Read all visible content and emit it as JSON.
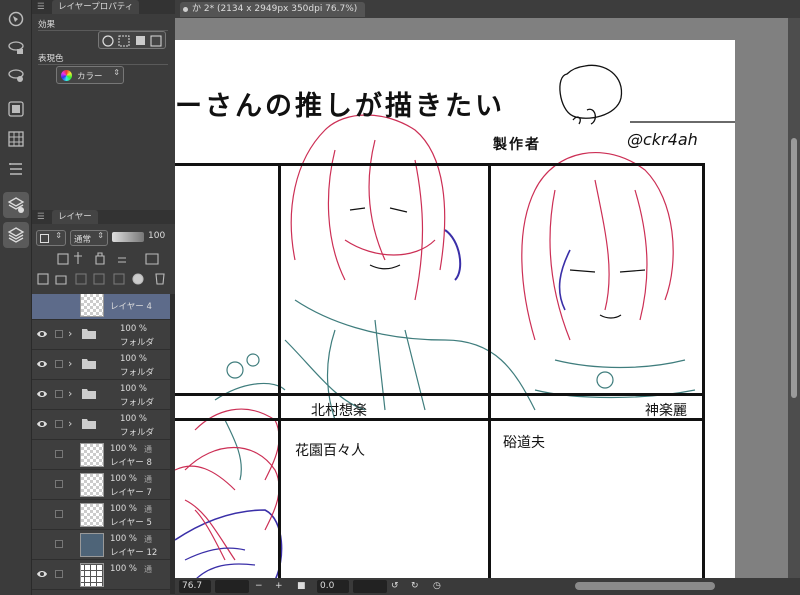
{
  "document_tab": {
    "title": "か 2* (2134 x 2949px 350dpi 76.7%)"
  },
  "left_strip": {
    "icons": [
      "navigator-icon",
      "sub-tool-detail-icon",
      "tool-property-icon",
      "material-icon",
      "color-set-icon",
      "layer-search-icon",
      "layer-property-icon",
      "layer-icon"
    ]
  },
  "property_panel": {
    "tab_label": "レイヤープロパティ",
    "effect_label": "効果",
    "expression_color_label": "表現色",
    "expression_color_value": "カラー"
  },
  "layer_panel": {
    "tab_label": "レイヤー",
    "blend_mode": "通常",
    "opacity": "100",
    "layers": [
      {
        "type": "layer",
        "name": "レイヤー 4",
        "opacity": "",
        "mode": "",
        "visible": false,
        "selected": true,
        "thumb": "transparent"
      },
      {
        "type": "folder",
        "name": "フォルダ",
        "opacity": "100 %",
        "mode": "",
        "visible": true,
        "selected": false
      },
      {
        "type": "folder",
        "name": "フォルダ",
        "opacity": "100 %",
        "mode": "",
        "visible": true,
        "selected": false
      },
      {
        "type": "folder",
        "name": "フォルダ",
        "opacity": "100 %",
        "mode": "",
        "visible": true,
        "selected": false
      },
      {
        "type": "folder",
        "name": "フォルダ",
        "opacity": "100 %",
        "mode": "",
        "visible": true,
        "selected": false
      },
      {
        "type": "layer",
        "name": "レイヤー 8",
        "opacity": "100 %",
        "mode": "通",
        "visible": false,
        "selected": false,
        "thumb": "transparent"
      },
      {
        "type": "layer",
        "name": "レイヤー 7",
        "opacity": "100 %",
        "mode": "通",
        "visible": false,
        "selected": false,
        "thumb": "transparent"
      },
      {
        "type": "layer",
        "name": "レイヤー 5",
        "opacity": "100 %",
        "mode": "通",
        "visible": false,
        "selected": false,
        "thumb": "transparent"
      },
      {
        "type": "layer",
        "name": "レイヤー 12",
        "opacity": "100 %",
        "mode": "通",
        "visible": false,
        "selected": false,
        "thumb": "dark"
      },
      {
        "type": "layer",
        "name": "",
        "opacity": "100 %",
        "mode": "通",
        "visible": true,
        "selected": false,
        "thumb": "grid"
      }
    ]
  },
  "canvas": {
    "title": "ーさんの推しが描きたい",
    "creator_label": "製作者",
    "handle": "@ckr4ah",
    "names": [
      "北村想楽",
      "神楽麗",
      "花園百々人",
      "硲道夫"
    ]
  },
  "status_bar": {
    "zoom": "76.7",
    "rotation": "0.0"
  },
  "colors": {
    "sketch_red": "#cc2f55",
    "sketch_teal": "#3f7d7d",
    "sketch_blue": "#3a2fa8",
    "selected_layer": "#5d6b8a"
  }
}
